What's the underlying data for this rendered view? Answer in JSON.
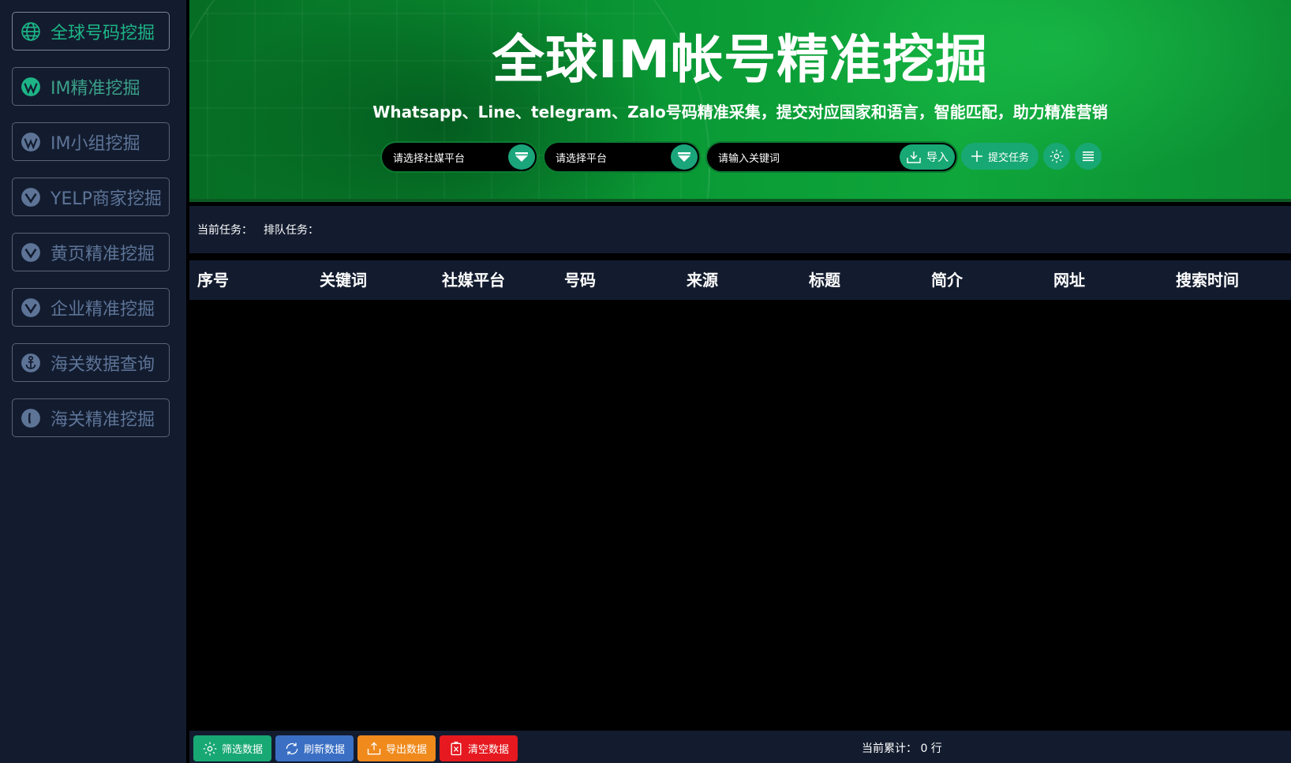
{
  "sidebar": {
    "items": [
      {
        "label": "全球号码挖掘",
        "icon": "globe-icon"
      },
      {
        "label": "IM精准挖掘",
        "icon": "wordpress-icon"
      },
      {
        "label": "IM小组挖掘",
        "icon": "wordpress-icon"
      },
      {
        "label": "YELP商家挖掘",
        "icon": "yelp-icon"
      },
      {
        "label": "黄页精准挖掘",
        "icon": "yelp-icon"
      },
      {
        "label": "企业精准挖掘",
        "icon": "yelp-icon"
      },
      {
        "label": "海关数据查询",
        "icon": "anchor-icon"
      },
      {
        "label": "海关精准挖掘",
        "icon": "pinterest-icon"
      }
    ]
  },
  "header": {
    "title": "全球IM帐号精准挖掘",
    "subtitle": "Whatsapp、Line、telegram、Zalo号码精准采集，提交对应国家和语言，智能匹配，助力精准营销",
    "social_select_placeholder": "请选择社媒平台",
    "platform_select_placeholder": "请选择平台",
    "keyword_placeholder": "请输入关键词",
    "import_label": "导入",
    "submit_label": "提交任务"
  },
  "taskbar": {
    "current_task_label": "当前任务：",
    "queue_task_label": "排队任务："
  },
  "table": {
    "columns": [
      "序号",
      "关键词",
      "社媒平台",
      "号码",
      "来源",
      "标题",
      "简介",
      "网址",
      "搜索时间"
    ]
  },
  "footer": {
    "filter_label": "筛选数据",
    "refresh_label": "刷新数据",
    "export_label": "导出数据",
    "clear_label": "清空数据",
    "total_text": "当前累计：  0  行"
  },
  "colors": {
    "sidebar_bg": "#131c2f",
    "accent_green": "#18a874",
    "refresh_blue": "#3a6fc4",
    "export_orange": "#f08a1c",
    "clear_red": "#e5191f"
  }
}
